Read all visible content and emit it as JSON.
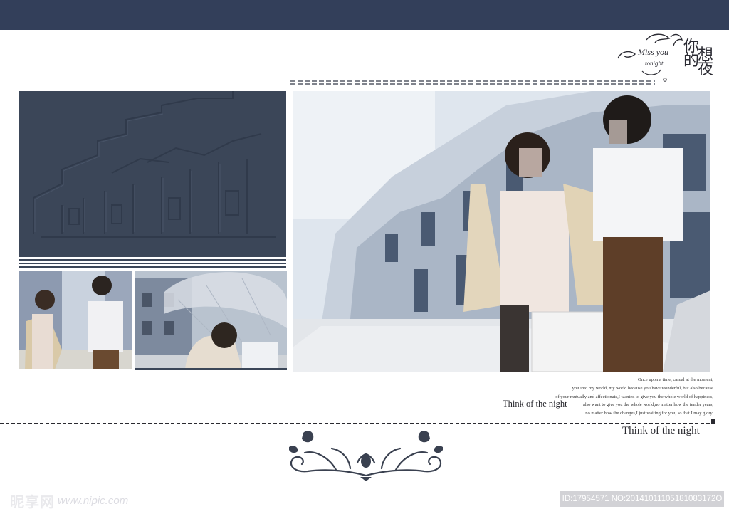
{
  "logo": {
    "script_line1": "Miss you",
    "script_line2": "tonight",
    "chinese_line1": "你的",
    "chinese_line2": "想夜"
  },
  "text_block": {
    "lines": [
      "Once upon a time, casual at the moment,",
      "you into my world, my world because you have wonderful, but also because",
      "of your mutually and affectionate,I wanted to give you the whole world of happiness,",
      "also want to give you the whole world,no matter how the tender years,",
      "no matter how the changes,I just waiting for you, so that I may glory."
    ],
    "subtitle": "Think of the night"
  },
  "footer_title": "Think of the night",
  "watermark": {
    "brand": "昵享网",
    "url": "www.nipic.com",
    "id_text": "ID:17954571 NO:20141011105181083172O"
  },
  "colors": {
    "topbar": "#333f5a",
    "panel": "#3b4658",
    "ink": "#2a2a30"
  }
}
